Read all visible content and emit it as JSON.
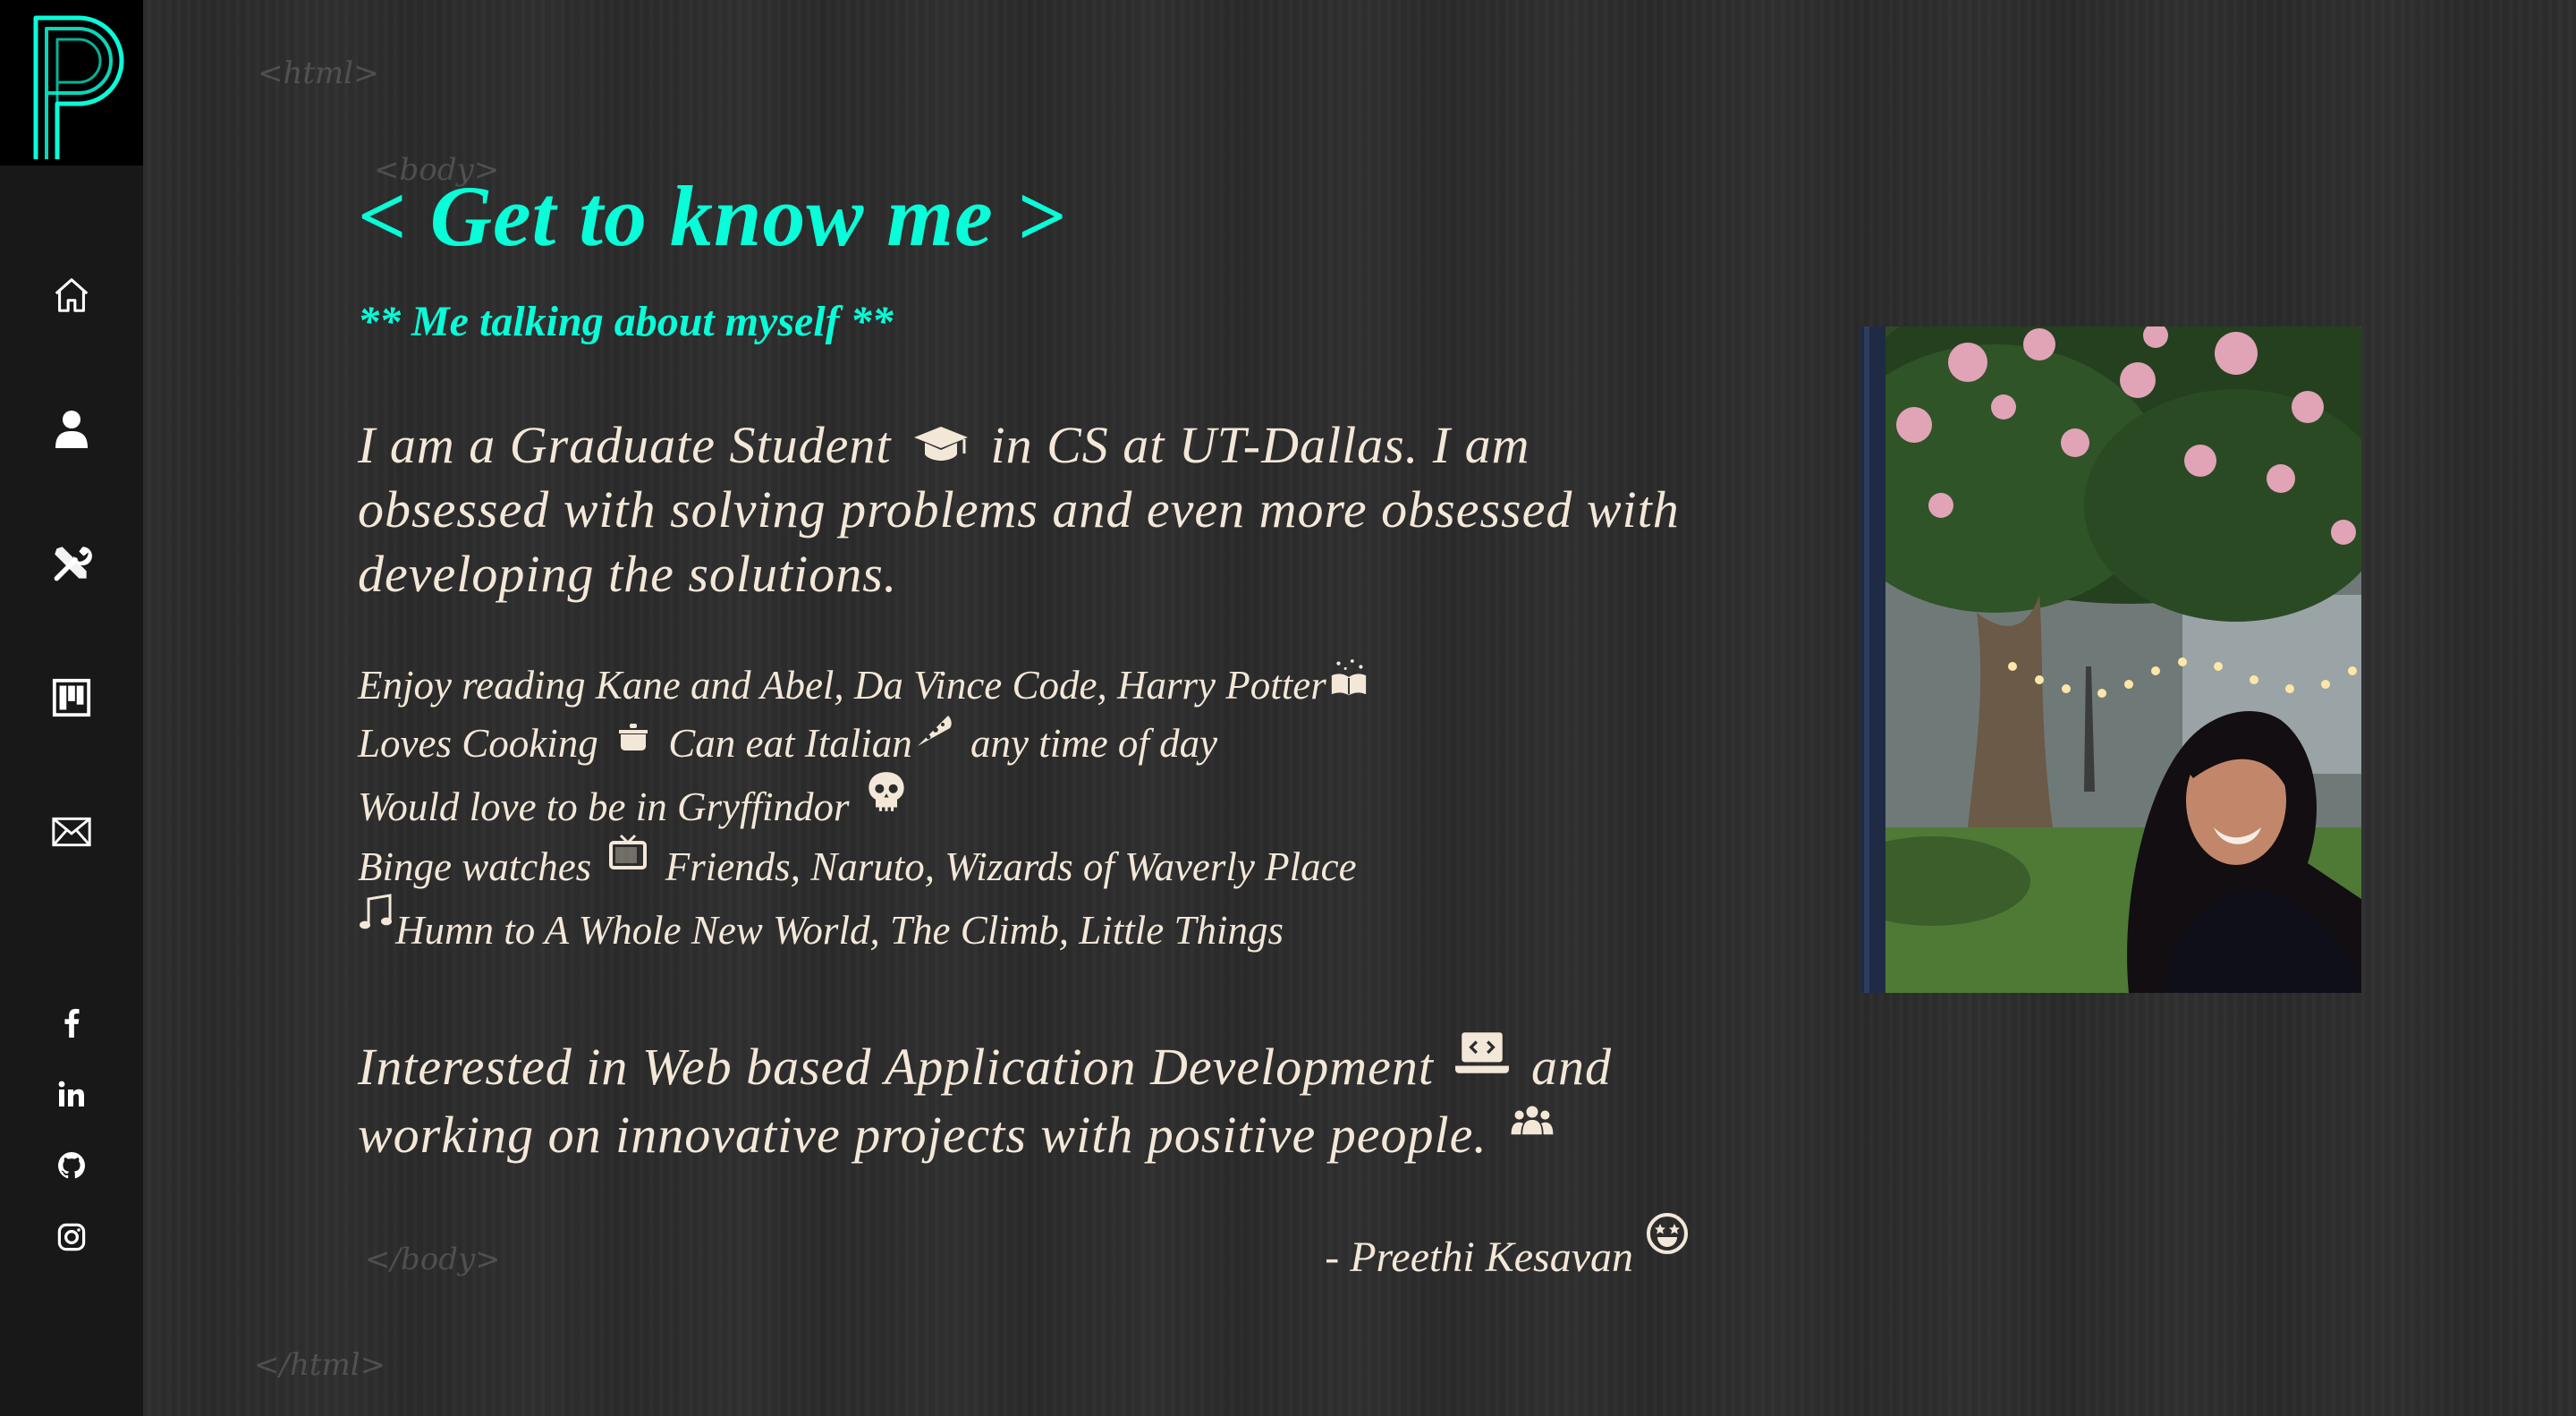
{
  "brand": {
    "logo_letter": "P"
  },
  "nav": [
    {
      "name": "home",
      "icon": "home-icon"
    },
    {
      "name": "about",
      "icon": "user-icon"
    },
    {
      "name": "skills",
      "icon": "tools-icon"
    },
    {
      "name": "work",
      "icon": "projects-board-icon"
    },
    {
      "name": "contact",
      "icon": "mail-icon"
    }
  ],
  "social": [
    {
      "name": "facebook",
      "icon": "facebook-icon"
    },
    {
      "name": "linkedin",
      "icon": "linkedin-icon"
    },
    {
      "name": "github",
      "icon": "github-icon"
    },
    {
      "name": "instagram",
      "icon": "instagram-icon"
    }
  ],
  "tags": {
    "html_open": "<html>",
    "body_open": "<body>",
    "body_close": "</body>",
    "html_close": "</html>"
  },
  "main": {
    "heading": "< Get to know me >",
    "subheading": "** Me talking about myself **",
    "intro_part1": "I am a Graduate Student",
    "intro_part2": "in CS at UT-Dallas. I am obsessed with solving problems and even more obsessed with developing the solutions.",
    "likes": {
      "reading": "Enjoy reading Kane and Abel, Da Vince Code, Harry Potter",
      "cooking_a": "Loves Cooking",
      "cooking_b": "Can eat Italian",
      "cooking_c": "any time of day",
      "house": "Would love to be in Gryffindor",
      "tv_a": "Binge watches",
      "tv_b": "Friends, Naruto, Wizards of Waverly Place",
      "music": "Humn to A Whole New World, The Climb, Little Things"
    },
    "interest_part1": "Interested in Web based Application Development",
    "interest_part2": "and working on innovative projects with positive people.",
    "signature": "- Preethi Kesavan"
  },
  "photo": {
    "subject": "portrait-photo"
  },
  "colors": {
    "accent": "#08fdd8",
    "text": "#f3e8d8",
    "background": "#2c2c2c",
    "sidebar": "#181818"
  }
}
